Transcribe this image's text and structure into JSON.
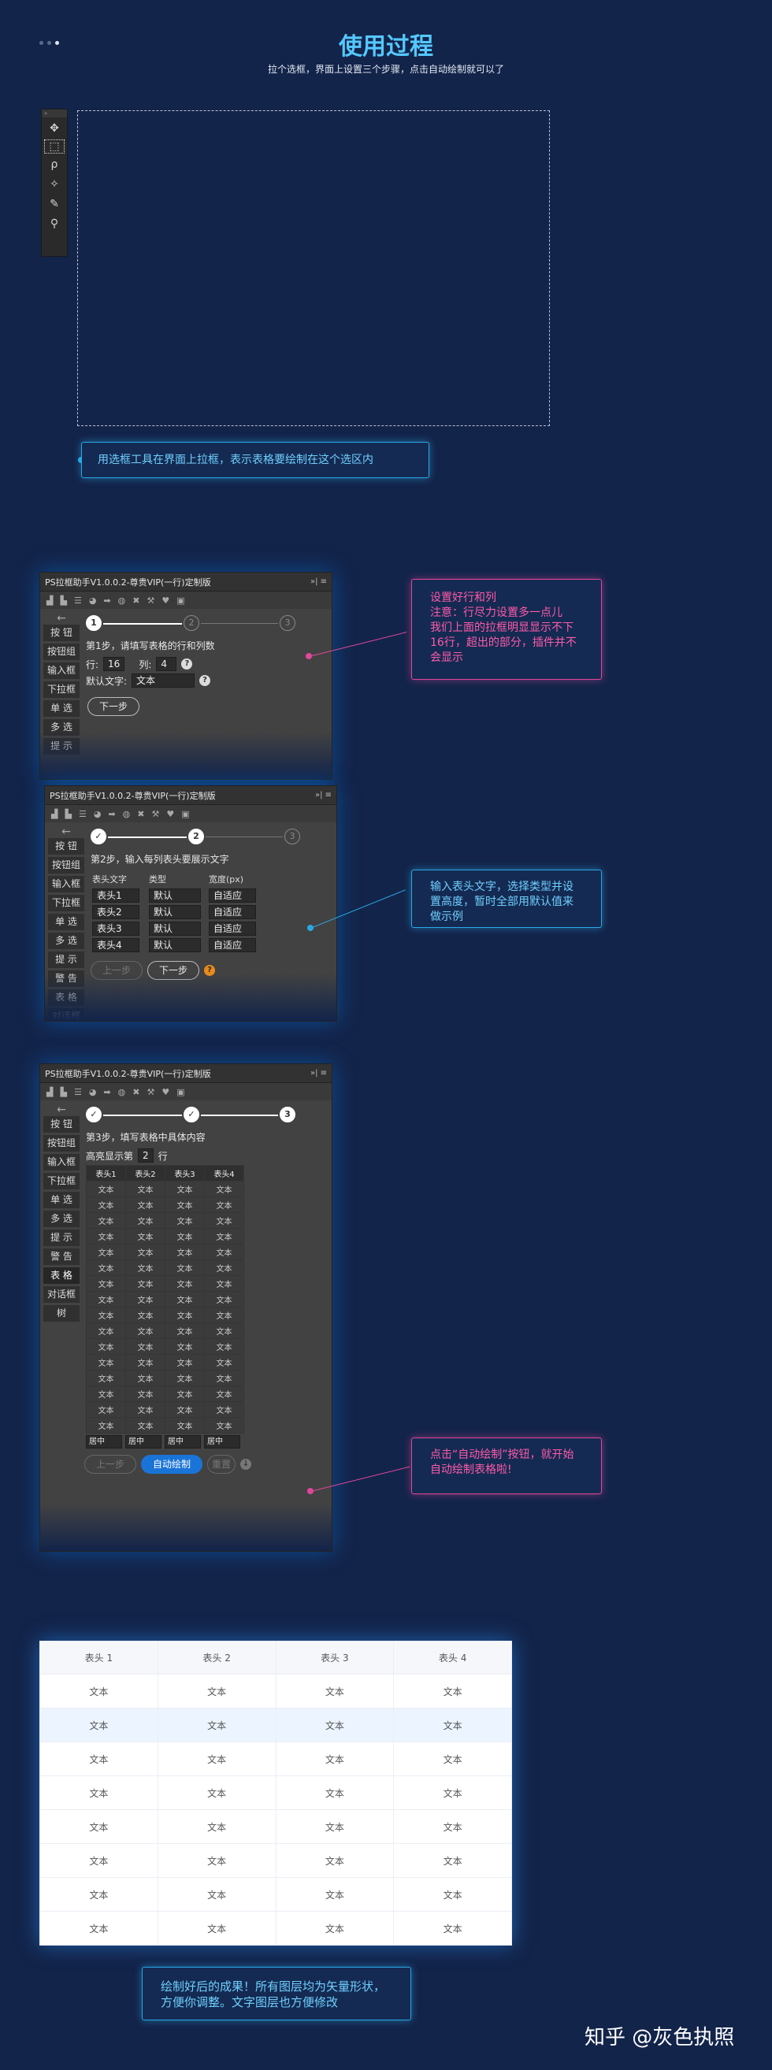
{
  "header": {
    "title": "使用过程",
    "subtitle": "拉个选框，界面上设置三个步骤，点击自动绘制就可以了"
  },
  "step0": {
    "callout": "用选框工具在界面上拉框，表示表格要绘制在这个选区内"
  },
  "panel": {
    "title": "PS拉框助手V1.0.0.2-尊贵VIP(一行)定制版",
    "controls": "»| ≡"
  },
  "sidebar": {
    "back": "←",
    "items": [
      "按 钮",
      "按钮组",
      "输入框",
      "下拉框",
      "单 选",
      "多 选",
      "提 示",
      "警 告",
      "表 格",
      "对话框",
      "树"
    ]
  },
  "step1": {
    "num1": "1",
    "num2": "2",
    "num3": "3",
    "instruction": "第1步，请填写表格的行和列数",
    "rows_label": "行:",
    "rows_value": "16",
    "cols_label": "列:",
    "cols_value": "4",
    "default_label": "默认文字:",
    "default_value": "文本",
    "next": "下一步",
    "callout": "设置好行和列\n注意：行尽力设置多一点儿\n我们上面的拉框明显显示不下16行，超出的部分，插件并不会显示"
  },
  "step2": {
    "instruction": "第2步，输入每列表头要展示文字",
    "col_headers": [
      "表头文字",
      "类型",
      "宽度(px)"
    ],
    "rows": [
      [
        "表头1",
        "默认",
        "自适应"
      ],
      [
        "表头2",
        "默认",
        "自适应"
      ],
      [
        "表头3",
        "默认",
        "自适应"
      ],
      [
        "表头4",
        "默认",
        "自适应"
      ]
    ],
    "prev": "上一步",
    "next": "下一步",
    "callout": "输入表头文字，选择类型并设置高度，暂时全部用默认值来做示例"
  },
  "step3": {
    "num3": "3",
    "instruction": "第3步，填写表格中具体内容",
    "highlight_label": "高亮显示第",
    "highlight_value": "2",
    "highlight_unit": "行",
    "headers": [
      "表头1",
      "表头2",
      "表头3",
      "表头4"
    ],
    "cell": "文本",
    "align": "居中",
    "prev": "上一步",
    "auto": "自动绘制",
    "reset": "重置",
    "callout": "点击“自动绘制”按钮，就开始自动绘制表格啦!"
  },
  "result": {
    "headers": [
      "表头 1",
      "表头 2",
      "表头 3",
      "表头 4"
    ],
    "cell": "文本",
    "callout": "绘制好后的成果！所有图层均为矢量形状，方便你调整。文字图层也方便修改"
  },
  "watermark": "知乎 @灰色执照",
  "colors": {
    "accent_blue": "#2aa8e4",
    "accent_pink": "#e0479a",
    "background": "#13244a",
    "primary": "#1a74d8"
  }
}
